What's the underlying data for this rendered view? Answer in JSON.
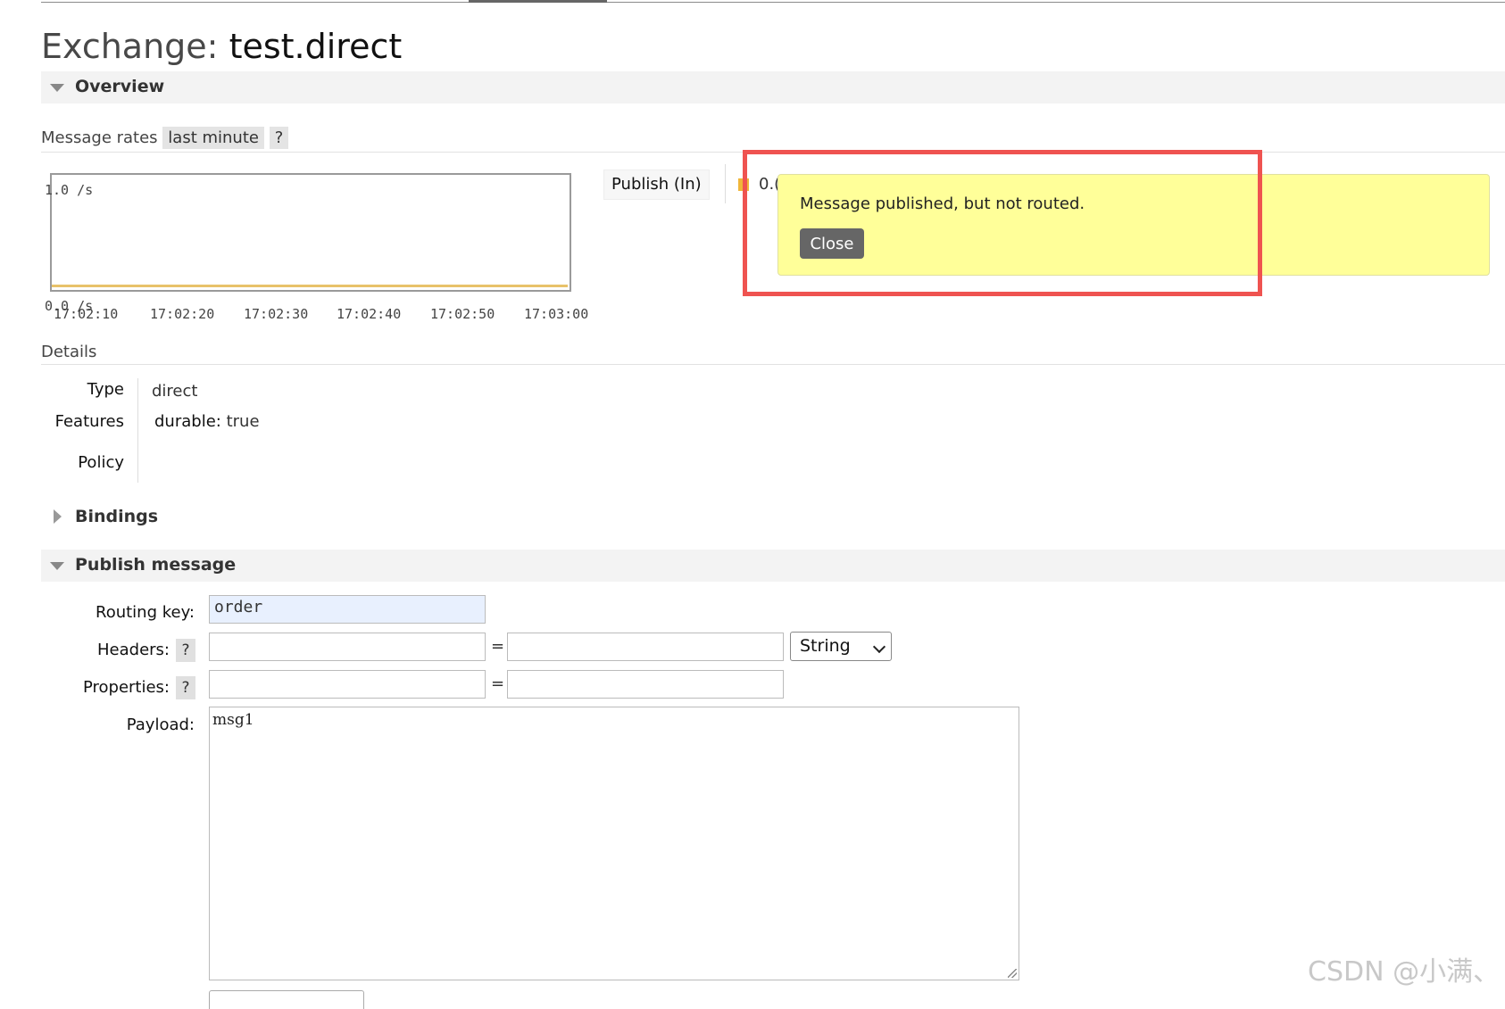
{
  "page": {
    "title_prefix": "Exchange:",
    "title_name": "test.direct"
  },
  "overview": {
    "label": "Overview",
    "message_rates_label": "Message rates",
    "rate_period": "last minute",
    "help": "?",
    "chart_data": {
      "type": "line",
      "y_top_label": "1.0 /s",
      "y_bottom_label": "0.0 /s",
      "ylim": [
        0,
        1
      ],
      "categories": [
        "17:02:10",
        "17:02:20",
        "17:02:30",
        "17:02:40",
        "17:02:50",
        "17:03:00"
      ],
      "series": [
        {
          "name": "Publish (In)",
          "color": "#f0b63a",
          "values": [
            0,
            0,
            0,
            0,
            0,
            0
          ]
        }
      ]
    },
    "legend_value_partial": "0.("
  },
  "popup": {
    "message": "Message published, but not routed.",
    "close_label": "Close",
    "bg_color": "#ffff99",
    "highlight_color": "#ef5350"
  },
  "details": {
    "label": "Details",
    "type_label": "Type",
    "type_value": "direct",
    "features_label": "Features",
    "durable_key": "durable:",
    "durable_value": "true",
    "policy_label": "Policy"
  },
  "bindings": {
    "label": "Bindings"
  },
  "publish": {
    "label": "Publish message",
    "routing_key_label": "Routing key:",
    "routing_key_value": "order",
    "headers_label": "Headers:",
    "properties_label": "Properties:",
    "help": "?",
    "equals": "=",
    "header_type": "String",
    "payload_label": "Payload:",
    "payload_value": "msg1"
  },
  "watermark": "CSDN @小满、"
}
